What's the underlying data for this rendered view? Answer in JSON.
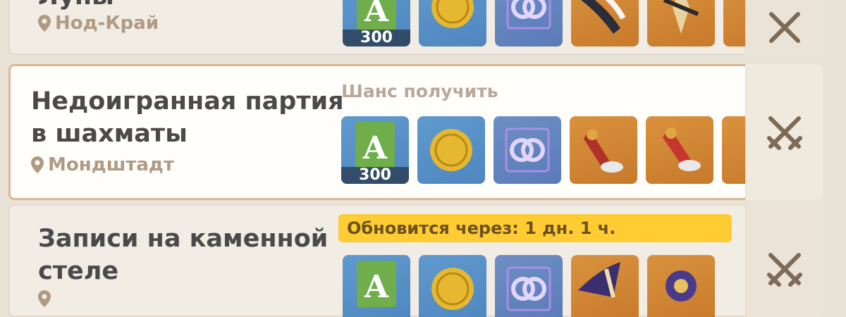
{
  "domains": [
    {
      "title": "Луны",
      "region": "Нод-Край",
      "rewards": [
        {
          "type": "adventure-exp",
          "count": "300"
        },
        {
          "type": "mora"
        },
        {
          "type": "companionship-exp"
        },
        {
          "type": "artifact-1"
        },
        {
          "type": "artifact-2"
        }
      ]
    },
    {
      "title": "Недоигранная партия\nв шахматы",
      "region": "Мондштадт",
      "header": "Шанс получить",
      "rewards": [
        {
          "type": "adventure-exp",
          "count": "300"
        },
        {
          "type": "mora"
        },
        {
          "type": "companionship-exp"
        },
        {
          "type": "artifact-red-1"
        },
        {
          "type": "artifact-red-2"
        }
      ]
    },
    {
      "title": "Записи на каменной\nстеле",
      "region": "",
      "header": "Обновится через: 1 дн. 1 ч.",
      "rewards": [
        {
          "type": "adventure-exp"
        },
        {
          "type": "mora"
        },
        {
          "type": "companionship-exp"
        },
        {
          "type": "artifact-purple-1"
        },
        {
          "type": "artifact-purple-2"
        }
      ]
    }
  ],
  "colors": {
    "selected_border": "#d9b895",
    "refresh_banner": "#ffcc33",
    "region_text": "#b09a84"
  }
}
